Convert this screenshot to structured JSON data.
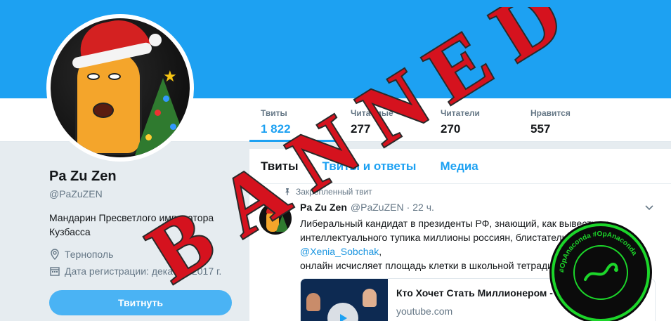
{
  "stats": [
    {
      "label": "Твиты",
      "value": "1 822"
    },
    {
      "label": "Читаемые",
      "value": "277"
    },
    {
      "label": "Читатели",
      "value": "270"
    },
    {
      "label": "Нравится",
      "value": "557"
    }
  ],
  "profile": {
    "name": "Pa Zu Zen",
    "handle": "@PaZuZEN",
    "bio": "Мандарин Пресветлого императора Кузбасса",
    "location": "Тернополь",
    "joined": "Дата регистрации: декабрь 2017 г.",
    "tweet_button": "Твитнуть"
  },
  "tabs": [
    "Твиты",
    "Твиты и ответы",
    "Медиа"
  ],
  "tweet": {
    "pinned_label": "Закрепленный твит",
    "author_name": "Pa Zu Zen",
    "author_handle": "@PaZuZEN",
    "separator": "·",
    "time": "22 ч.",
    "text_line1": "Либеральный кандидат в президенты РФ, знающий, как вывести из интеллектуального тупика миллионы россиян, блистательная",
    "mention": "@Xenia_Sobchak",
    "mention_suffix": ",",
    "text_line2": "онлайн исчисляет площадь клетки в школьной тетради",
    "card_title": "Кто Хочет Стать Миллионером - Ксения",
    "card_domain": "youtube.com"
  },
  "overlay": {
    "banned_letters": [
      "B",
      "A",
      "N",
      "N",
      "E",
      "D"
    ],
    "badge_text": "#OpAnaconda  #OpAnaconda"
  },
  "colors": {
    "twitter_blue": "#1da1f2",
    "banned_red": "#d5121e",
    "badge_green": "#1cd62a"
  }
}
